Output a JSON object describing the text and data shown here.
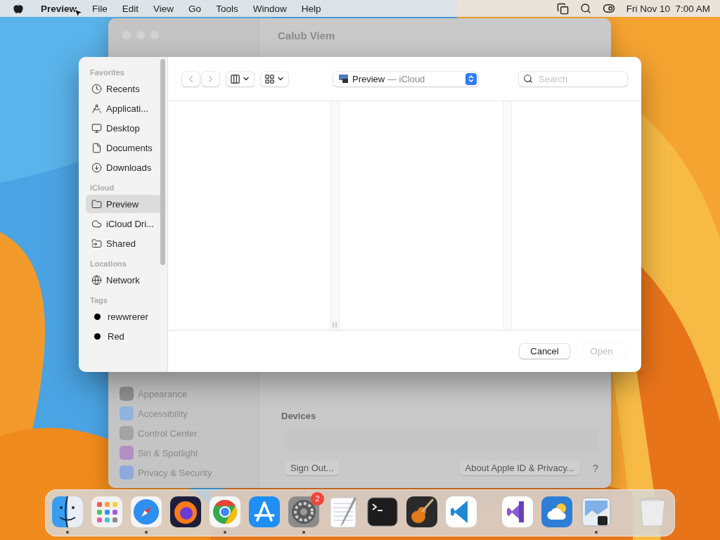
{
  "menu_bar": {
    "app": "Preview",
    "items": [
      "File",
      "Edit",
      "View",
      "Go",
      "Tools",
      "Window",
      "Help"
    ],
    "clock": "Fri Nov 10  7:00 AM"
  },
  "background_window": {
    "title": "Calub Viem",
    "sidebar": [
      "Appearance",
      "Accessibility",
      "Control Center",
      "Siri & Spotlight",
      "Privacy & Security"
    ],
    "section": "Devices",
    "buttons": [
      "Sign Out...",
      "About Apple ID & Privacy..."
    ],
    "help": "?"
  },
  "dialog": {
    "sidebar": [
      {
        "heading": "Favorites",
        "items": [
          {
            "label": "Recents",
            "kind": "place",
            "selected": false
          },
          {
            "label": "Applicati...",
            "kind": "place",
            "selected": false
          },
          {
            "label": "Desktop",
            "kind": "place",
            "selected": false
          },
          {
            "label": "Documents",
            "kind": "place",
            "selected": false
          },
          {
            "label": "Downloads",
            "kind": "place",
            "selected": false
          }
        ]
      },
      {
        "heading": "iCloud",
        "items": [
          {
            "label": "Preview",
            "kind": "place",
            "selected": true
          },
          {
            "label": "iCloud Dri...",
            "kind": "place",
            "selected": false
          },
          {
            "label": "Shared",
            "kind": "place",
            "selected": false
          }
        ]
      },
      {
        "heading": "Locations",
        "items": [
          {
            "label": "Network",
            "kind": "place",
            "selected": false
          }
        ]
      },
      {
        "heading": "Tags",
        "items": [
          {
            "label": "rewwrerer",
            "kind": "tag",
            "color": "#000000",
            "selected": false
          },
          {
            "label": "Red",
            "kind": "tag",
            "color": "#000000",
            "selected": false
          }
        ]
      }
    ],
    "toolbar": {
      "back_disabled": true,
      "forward_disabled": true,
      "location": {
        "name": "Preview",
        "detail": "— iCloud"
      },
      "search": {
        "placeholder": "Search"
      }
    },
    "buttons": [
      {
        "label": "Cancel",
        "disabled": false
      },
      {
        "label": "Open",
        "disabled": true
      }
    ]
  },
  "dock": {
    "sections": [
      {
        "apps": [
          {
            "kind": "finder",
            "running": true
          },
          {
            "kind": "launchpad",
            "running": false
          },
          {
            "kind": "safari",
            "running": true
          },
          {
            "kind": "firefox",
            "running": false
          },
          {
            "kind": "chrome",
            "running": true
          },
          {
            "kind": "appstore",
            "running": false
          },
          {
            "kind": "settings",
            "running": true,
            "badge": "2"
          },
          {
            "kind": "textedit",
            "running": false
          },
          {
            "kind": "terminal",
            "running": false
          },
          {
            "kind": "guitar",
            "running": false
          },
          {
            "kind": "vscode",
            "running": false
          }
        ]
      },
      {
        "apps": [
          {
            "kind": "vstudio",
            "running": false
          },
          {
            "kind": "weather",
            "running": false
          },
          {
            "kind": "preview",
            "running": true
          }
        ]
      },
      {
        "apps": [
          {
            "kind": "trash",
            "running": false
          }
        ]
      }
    ]
  }
}
